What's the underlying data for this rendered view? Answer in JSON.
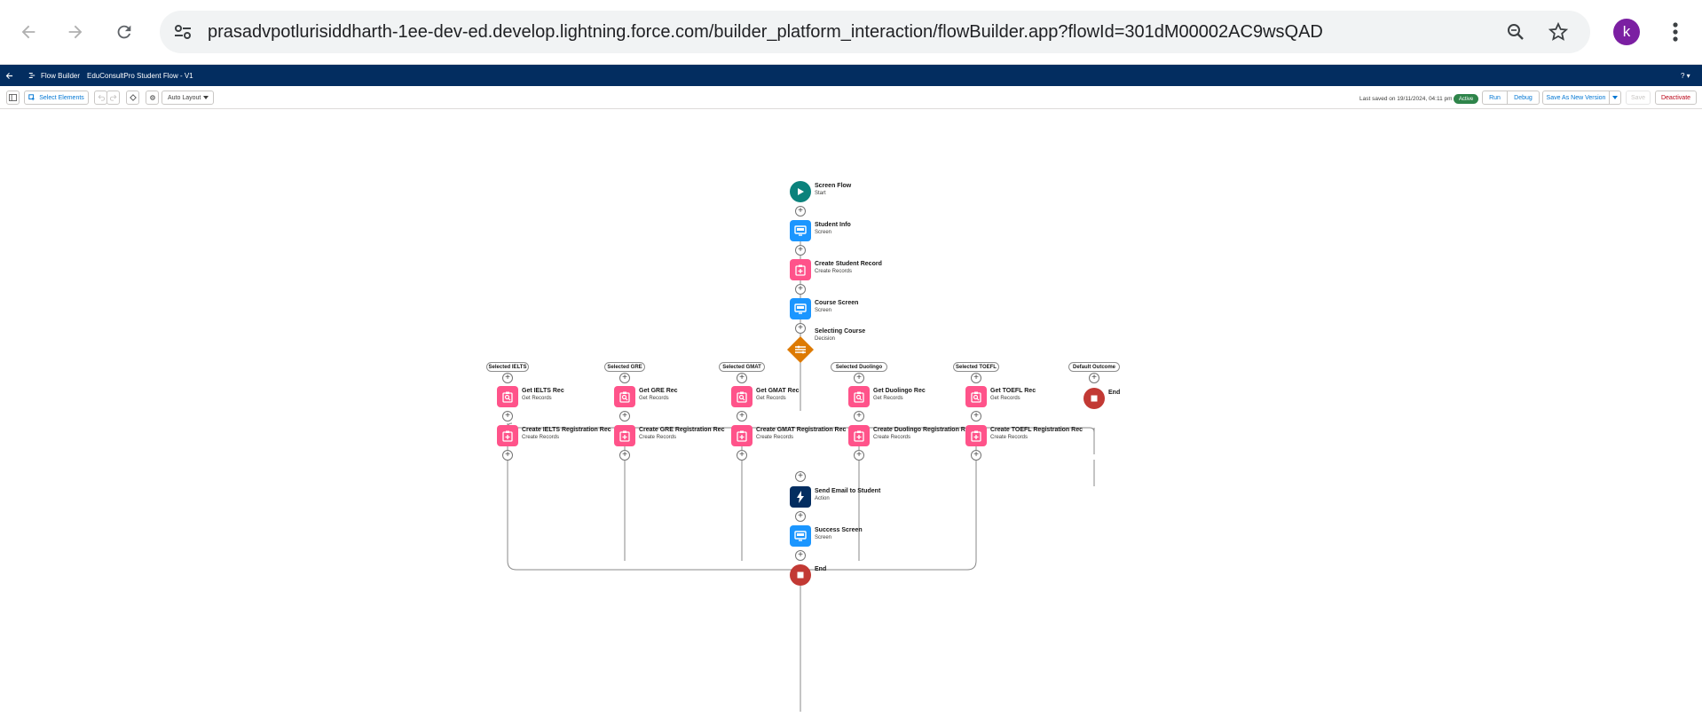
{
  "browser": {
    "url": "prasadvpotlurisiddharth-1ee-dev-ed.develop.lightning.force.com/builder_platform_interaction/flowBuilder.app?flowId=301dM00002AC9wsQAD",
    "avatar_letter": "k"
  },
  "header": {
    "app_name": "Flow Builder",
    "flow_name": "EduConsultPro Student Flow - V1",
    "help": "? ▾"
  },
  "toolbar": {
    "select_elements": "Select Elements",
    "layout": "Auto Layout",
    "last_saved": "Last saved on 19/11/2024, 04:11 pm",
    "status": "Active",
    "run": "Run",
    "debug": "Debug",
    "save_as_new_version": "Save As New Version",
    "save": "Save",
    "deactivate": "Deactivate"
  },
  "flow": {
    "start": {
      "title": "Screen Flow",
      "subtitle": "Start"
    },
    "student_info": {
      "title": "Student Info",
      "subtitle": "Screen"
    },
    "create_student": {
      "title": "Create Student Record",
      "subtitle": "Create Records"
    },
    "course_screen": {
      "title": "Course Screen",
      "subtitle": "Screen"
    },
    "decision": {
      "title": "Selecting Course",
      "subtitle": "Decision"
    },
    "outcomes": [
      {
        "label": "Selected IELTS",
        "get_title": "Get IELTS Rec",
        "get_sub": "Get Records",
        "create_title": "Create IELTS Registration Rec",
        "create_sub": "Create Records"
      },
      {
        "label": "Selected GRE",
        "get_title": "Get GRE Rec",
        "get_sub": "Get Records",
        "create_title": "Create GRE Registration Rec",
        "create_sub": "Create Records"
      },
      {
        "label": "Selected GMAT",
        "get_title": "Get GMAT Rec",
        "get_sub": "Get Records",
        "create_title": "Create GMAT Registration Rec",
        "create_sub": "Create Records"
      },
      {
        "label": "Selected Duolingo",
        "get_title": "Get Duolingo Rec",
        "get_sub": "Get Records",
        "create_title": "Create Duolingo Registration Rec",
        "create_sub": "Create Records"
      },
      {
        "label": "Selected TOEFL",
        "get_title": "Get TOEFL Rec",
        "get_sub": "Get Records",
        "create_title": "Create TOEFL Registration Rec",
        "create_sub": "Create Records"
      }
    ],
    "default_outcome": {
      "label": "Default Outcome",
      "end_title": "End"
    },
    "send_email": {
      "title": "Send Email to Student",
      "subtitle": "Action"
    },
    "success_screen": {
      "title": "Success Screen",
      "subtitle": "Screen"
    },
    "end": {
      "title": "End"
    }
  },
  "colors": {
    "header_bg": "#032d60",
    "start": "#0b827c",
    "screen": "#1b96ff",
    "records": "#ff538a",
    "decision": "#dd7a01",
    "action": "#032d60",
    "end": "#c23934",
    "active": "#2e844a"
  }
}
